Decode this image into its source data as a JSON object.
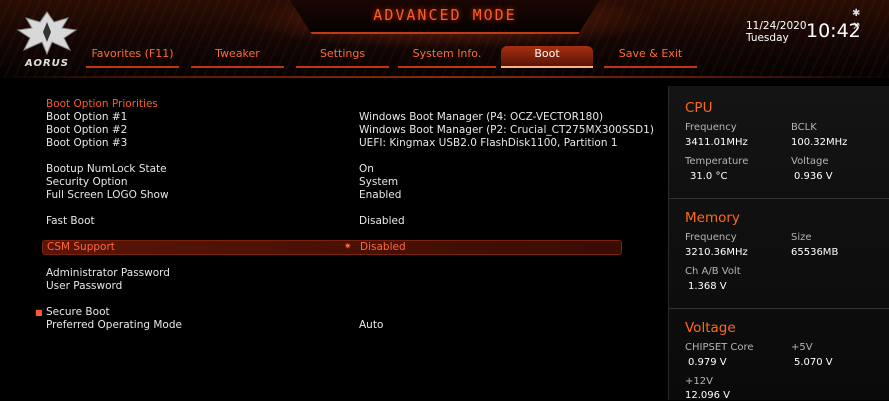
{
  "header": {
    "title": "ADVANCED MODE",
    "logo_text": "AORUS",
    "date": "11/24/2020",
    "day": "Tuesday",
    "time": "10:42",
    "tabs": [
      {
        "label": "Favorites (F11)"
      },
      {
        "label": "Tweaker"
      },
      {
        "label": "Settings"
      },
      {
        "label": "System Info."
      },
      {
        "label": "Boot"
      },
      {
        "label": "Save & Exit"
      }
    ],
    "active_tab": "Boot"
  },
  "boot": {
    "priorities_heading": "Boot Option Priorities",
    "options": [
      {
        "label": "Boot Option #1",
        "value": "Windows Boot Manager (P4: OCZ-VECTOR180)"
      },
      {
        "label": "Boot Option #2",
        "value": "Windows Boot Manager (P2: Crucial_CT275MX300SSD1)"
      },
      {
        "label": "Boot Option #3",
        "value": "UEFI: Kingmax USB2.0 FlashDisk1100, Partition 1"
      }
    ],
    "settings": {
      "numlock": {
        "label": "Bootup NumLock State",
        "value": "On"
      },
      "security": {
        "label": "Security Option",
        "value": "System"
      },
      "logo": {
        "label": "Full Screen LOGO Show",
        "value": "Enabled"
      },
      "fast_boot": {
        "label": "Fast Boot",
        "value": "Disabled"
      },
      "csm": {
        "label": "CSM Support",
        "value": "Disabled"
      },
      "admin_pw": {
        "label": "Administrator Password"
      },
      "user_pw": {
        "label": "User Password"
      },
      "secure_boot": {
        "label": "Secure Boot"
      },
      "preferred_os": {
        "label": "Preferred Operating Mode",
        "value": "Auto"
      }
    }
  },
  "panel": {
    "cpu": {
      "heading": "CPU",
      "frequency_label": "Frequency",
      "frequency": "3411.01MHz",
      "bclk_label": "BCLK",
      "bclk": "100.32MHz",
      "temp_label": "Temperature",
      "temp": "31.0 °C",
      "voltage_label": "Voltage",
      "voltage": "0.936 V"
    },
    "memory": {
      "heading": "Memory",
      "frequency_label": "Frequency",
      "frequency": "3210.36MHz",
      "size_label": "Size",
      "size": "65536MB",
      "ab_label": "Ch A/B Volt",
      "ab": "1.368 V"
    },
    "voltage": {
      "heading": "Voltage",
      "chipset_label": "CHIPSET Core",
      "chipset": "0.979 V",
      "v5_label": "+5V",
      "v5": "5.070 V",
      "v12_label": "+12V",
      "v12": "12.096 V"
    }
  },
  "colors": {
    "accent": "#ff5a2a",
    "highlight_bg": "#5a1508",
    "background": "#000000"
  }
}
